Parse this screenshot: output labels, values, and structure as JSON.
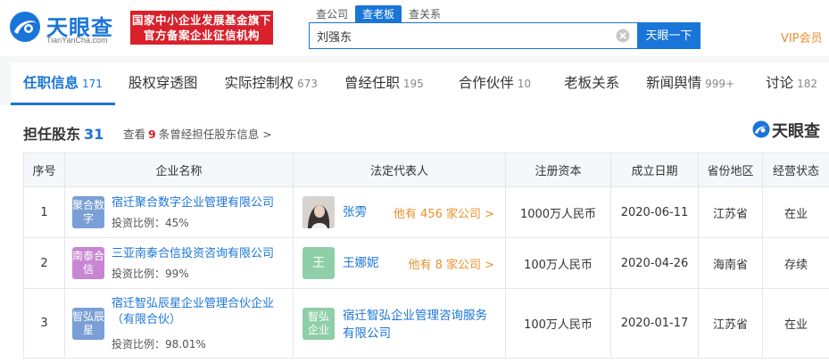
{
  "header": {
    "logo_text": "天眼查",
    "logo_sub": "TianYanCha.com",
    "badge_line1": "国家中小企业发展基金旗下",
    "badge_line2": "官方备案企业征信机构",
    "search_tabs": [
      "查公司",
      "查老板",
      "查关系"
    ],
    "search_value": "刘强东",
    "search_button": "天眼一下",
    "vip": "VIP会员"
  },
  "nav": [
    {
      "label": "任职信息",
      "count": "171",
      "active": true
    },
    {
      "label": "股权穿透图",
      "count": ""
    },
    {
      "label": "实际控制权",
      "count": "673"
    },
    {
      "label": "曾经任职",
      "count": "195"
    },
    {
      "label": "合作伙伴",
      "count": "10"
    },
    {
      "label": "老板关系",
      "count": ""
    },
    {
      "label": "新闻舆情",
      "count": "999+"
    },
    {
      "label": "讨论",
      "count": "182"
    }
  ],
  "section": {
    "title": "担任股东",
    "count": "31",
    "history_prefix": "查看",
    "history_num": "9",
    "history_suffix": "条曾经担任股东信息 >",
    "brand": "天眼查"
  },
  "table": {
    "headers": [
      "序号",
      "企业名称",
      "法定代表人",
      "注册资本",
      "成立日期",
      "省份地区",
      "经营状态"
    ],
    "rows": [
      {
        "index": "1",
        "avatar_text": "聚合数字",
        "name": "宿迁聚合数字企业管理有限公司",
        "ratio": "投资比例：45%",
        "rep_name": "张雱",
        "rep_more": "他有 456 家公司 >",
        "capital": "1000万人民币",
        "date": "2020-06-11",
        "region": "江苏省",
        "status": "在业"
      },
      {
        "index": "2",
        "avatar_text": "南泰合信",
        "name": "三亚南泰合信投资咨询有限公司",
        "ratio": "投资比例：99%",
        "rep_avatar": "王",
        "rep_name": "王娜妮",
        "rep_more": "他有 8 家公司 >",
        "capital": "100万人民币",
        "date": "2020-04-26",
        "region": "海南省",
        "status": "存续"
      },
      {
        "index": "3",
        "avatar_text": "智弘辰星",
        "name": "宿迁智弘辰星企业管理合伙企业（有限合伙）",
        "ratio": "投资比例：98.01%",
        "rep_avatar": "智弘企业",
        "rep_name": "宿迁智弘企业管理咨询服务有限公司",
        "capital": "100万人民币",
        "date": "2020-01-17",
        "region": "江苏省",
        "status": "在业"
      }
    ]
  },
  "colors": {
    "brand_blue": "#1a75d8",
    "badge_red": "#d9212b",
    "status_green": "#21a33c",
    "accent_orange": "#e8912d"
  }
}
